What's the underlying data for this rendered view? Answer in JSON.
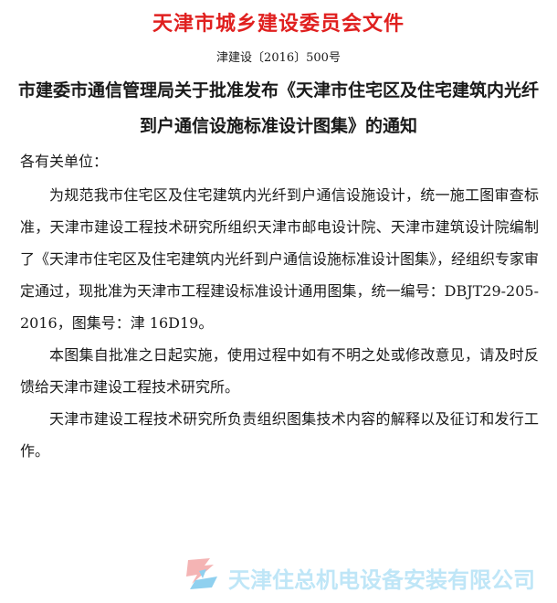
{
  "document": {
    "header": "天津市城乡建设委员会文件",
    "number": "津建设〔2016〕500号",
    "title": "市建委市通信管理局关于批准发布《天津市住宅区及住宅建筑内光纤到户通信设施标准设计图集》的通知",
    "salutation": "各有关单位：",
    "paragraphs": [
      "为规范我市住宅区及住宅建筑内光纤到户通信设施设计，统一施工图审查标准，天津市建设工程技术研究所组织天津市邮电设计院、天津市建筑设计院编制了《天津市住宅区及住宅建筑内光纤到户通信设施标准设计图集》，经组织专家审定通过，现批准为天津市工程建设标准设计通用图集，统一编号：DBJT29-205-2016，图集号：津 16D19。",
      "本图集自批准之日起实施，使用过程中如有不明之处或修改意见，请及时反馈给天津市建设工程技术研究所。",
      "天津市建设工程技术研究所负责组织图集技术内容的解释以及征订和发行工作。"
    ]
  },
  "watermark": {
    "company_name": "天津住总机电设备安装有限公司",
    "logo_icon": "company-logo-icon"
  },
  "colors": {
    "header_red": "#e0201f",
    "watermark_blue": "#bfe6f7",
    "logo_red": "#f4b4b4",
    "logo_blue": "#8fd0ef"
  }
}
